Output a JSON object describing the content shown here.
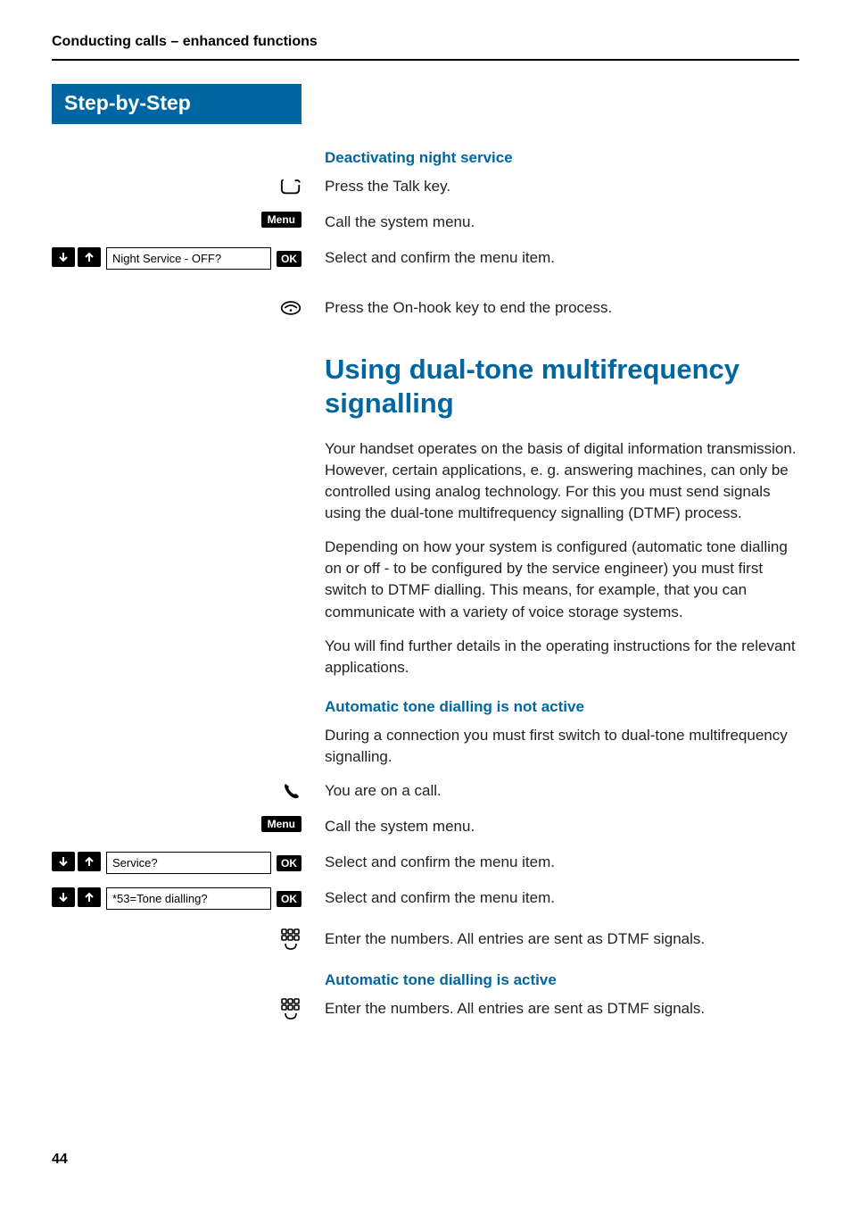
{
  "running_head": "Conducting calls – enhanced functions",
  "step_header": "Step-by-Step",
  "badges": {
    "menu": "Menu",
    "ok": "OK"
  },
  "deactivate": {
    "heading": "Deactivating night service",
    "press_talk": "Press the Talk key.",
    "call_menu": "Call the system menu.",
    "menu_item": "Night Service - OFF?",
    "select_confirm": "Select and confirm the menu item.",
    "press_onhook": "Press the On-hook key to end the process."
  },
  "dtmf": {
    "heading": "Using dual-tone multifrequency signalling",
    "p1": "Your handset operates on the basis of digital information transmission. However, certain applications, e. g. answering machines, can only be controlled using analog technology. For this you must send signals using the dual-tone multifrequency signalling (DTMF) process.",
    "p2": "Depending on how your system is configured (automatic tone dialling on or off - to be configured by the service engineer) you must first switch to DTMF dialling. This means, for example, that you can communicate with a variety of voice storage systems.",
    "p3": "You will find further details in the operating instructions for the relevant applications."
  },
  "auto_inactive": {
    "heading": "Automatic tone dialling is not active",
    "intro": "During a connection you must first switch to dual-tone multifrequency signalling.",
    "on_call": "You are on a call.",
    "call_menu": "Call the system menu.",
    "service_item": "Service?",
    "select_confirm1": "Select and confirm the menu item.",
    "tone_item": "*53=Tone dialling?",
    "select_confirm2": "Select and confirm the menu item.",
    "enter_numbers": "Enter the numbers. All entries are sent as DTMF signals."
  },
  "auto_active": {
    "heading": "Automatic tone dialling is active",
    "enter_numbers": "Enter the numbers. All entries are sent as DTMF signals."
  },
  "page_number": "44"
}
